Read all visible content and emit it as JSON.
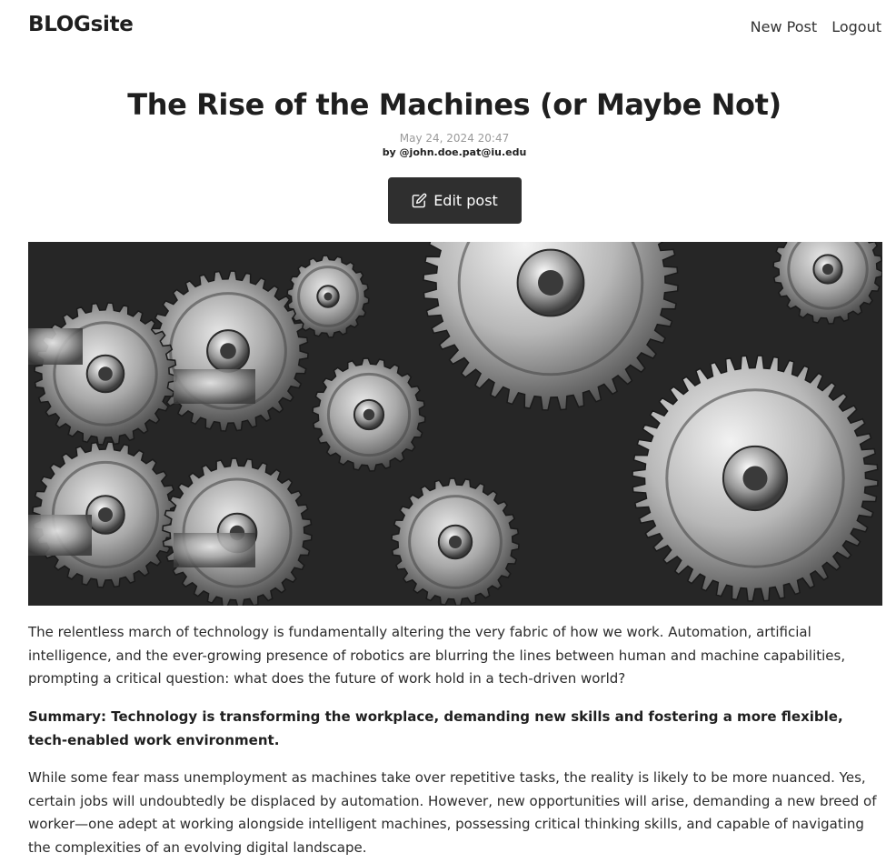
{
  "header": {
    "brand": "BLOGsite",
    "nav": {
      "new_post": "New Post",
      "logout": "Logout"
    }
  },
  "post": {
    "title": "The Rise of the Machines (or Maybe Not)",
    "date": "May 24, 2024 20:47",
    "author": "by @john.doe.pat@iu.edu",
    "edit_label": "Edit post",
    "edit_icon": "edit-icon",
    "image_subject": "gears",
    "paragraphs": [
      "The relentless march of technology is fundamentally altering the very fabric of how we work. Automation, artificial intelligence, and the ever-growing presence of robotics are blurring the lines between human and machine capabilities, prompting a critical question: what does the future of work hold in a tech-driven world?",
      "Summary: Technology is transforming the workplace, demanding new skills and fostering a more flexible, tech-enabled work environment.",
      "While some fear mass unemployment as machines take over repetitive tasks, the reality is likely to be more nuanced. Yes, certain jobs will undoubtedly be displaced by automation. However, new opportunities will arise, demanding a new breed of worker—one adept at working alongside intelligent machines, possessing critical thinking skills, and capable of navigating the complexities of an evolving digital landscape."
    ]
  },
  "colors": {
    "button_bg": "#2f2f2f",
    "text": "#222222",
    "date": "#9a9a9a"
  }
}
